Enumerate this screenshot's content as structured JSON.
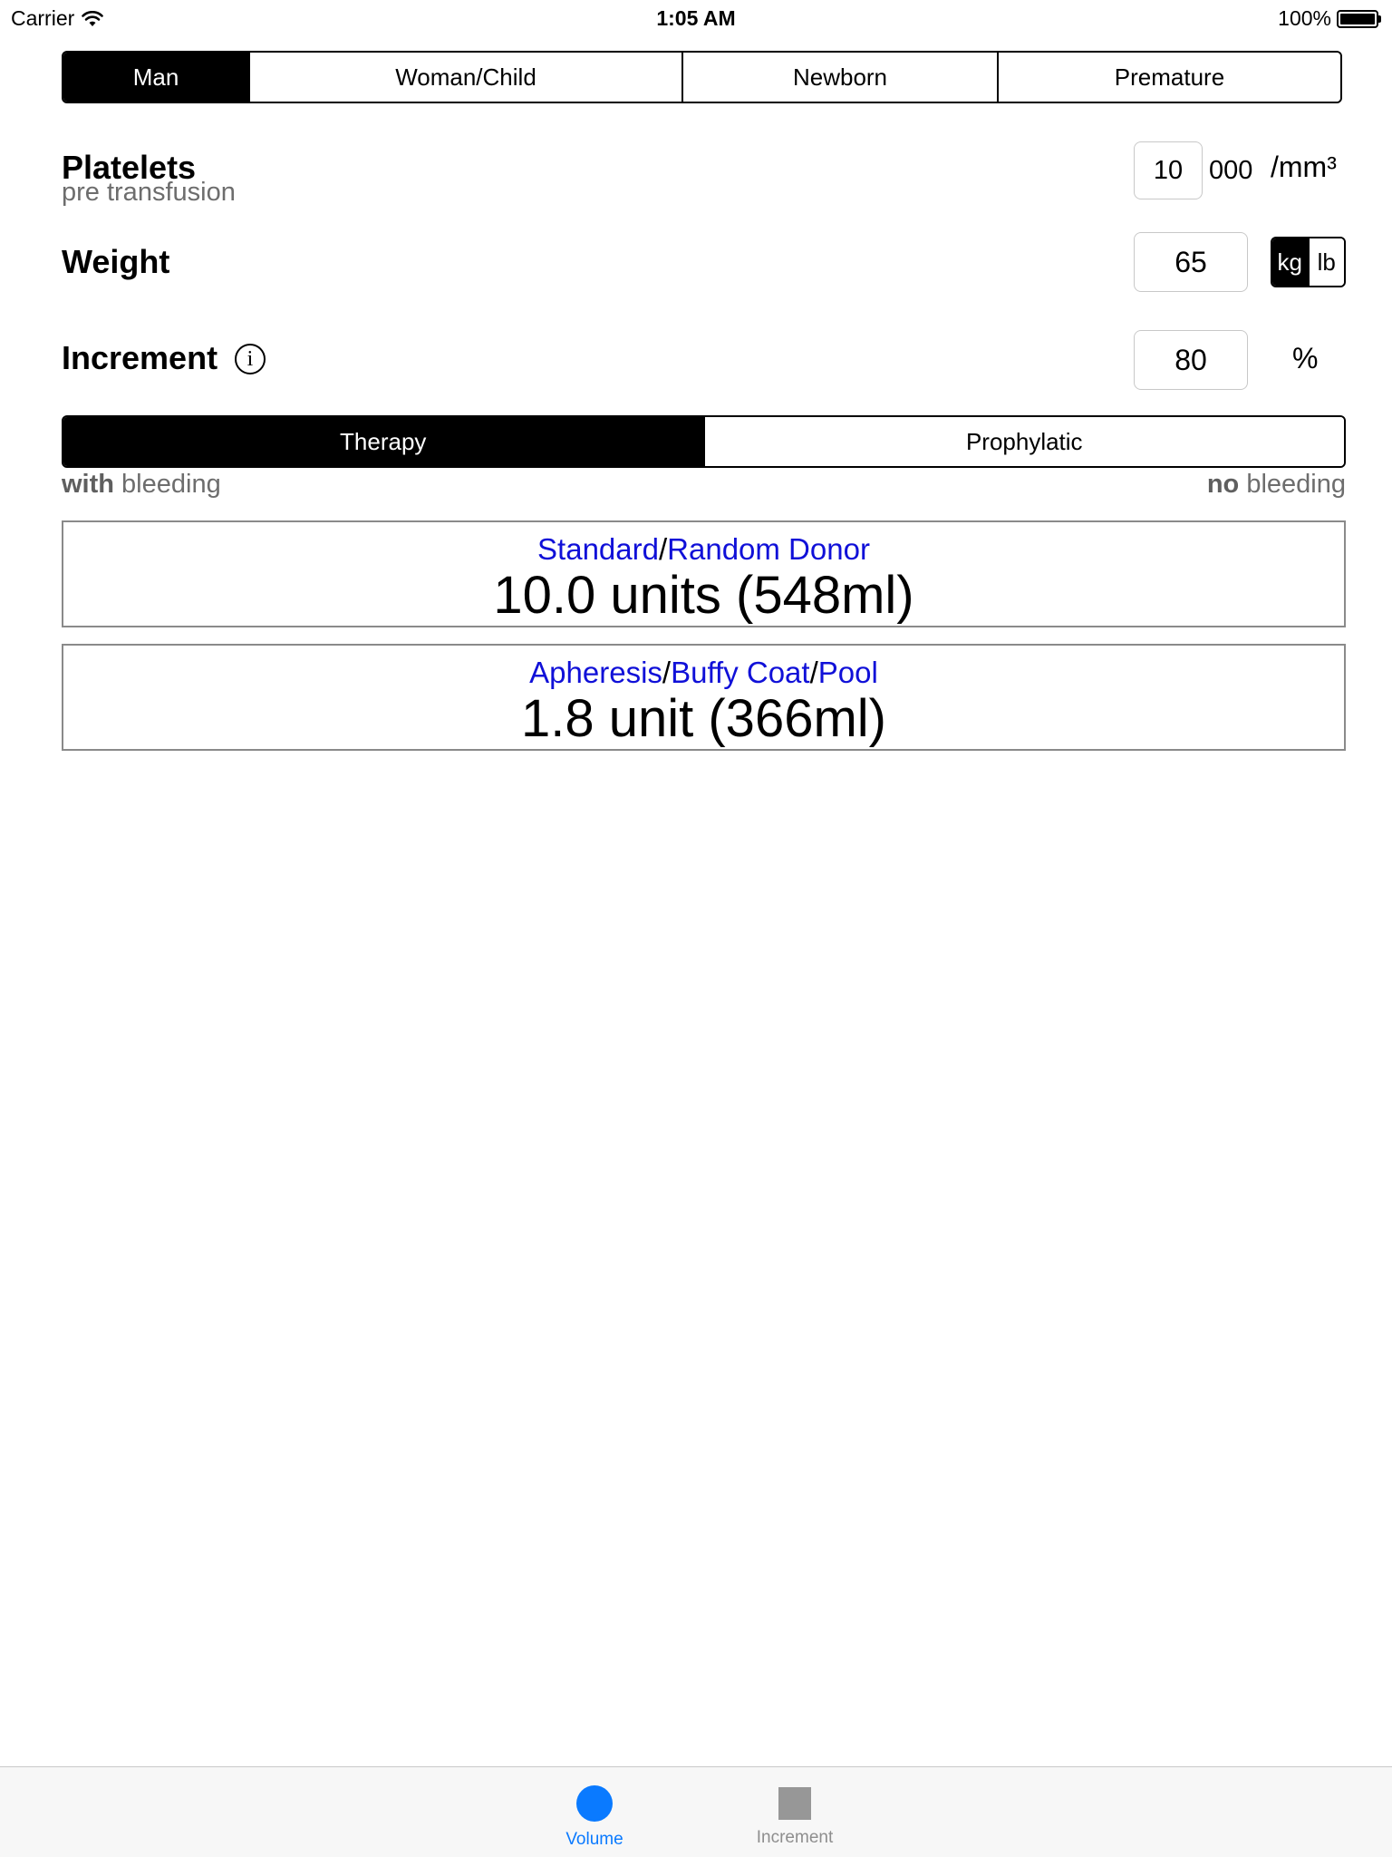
{
  "status_bar": {
    "carrier": "Carrier",
    "time": "1:05 AM",
    "battery": "100%"
  },
  "patient_tabs": [
    {
      "label": "Man",
      "selected": true
    },
    {
      "label": "Woman/Child",
      "selected": false
    },
    {
      "label": "Newborn",
      "selected": false
    },
    {
      "label": "Premature",
      "selected": false
    }
  ],
  "platelets": {
    "label": "Platelets",
    "sublabel": "pre transfusion",
    "value": "10",
    "suffix": "000",
    "unit": "/mm³"
  },
  "weight": {
    "label": "Weight",
    "value": "65",
    "units": [
      {
        "label": "kg",
        "selected": true
      },
      {
        "label": "lb",
        "selected": false
      }
    ]
  },
  "increment": {
    "label": "Increment",
    "info_icon": "info-icon",
    "value": "80",
    "unit": "%"
  },
  "mode_tabs": [
    {
      "label": "Therapy",
      "selected": true
    },
    {
      "label": "Prophylatic",
      "selected": false
    }
  ],
  "mode_hints": {
    "left_bold": "with",
    "left_rest": " bleeding",
    "right_bold": "no",
    "right_rest": " bleeding"
  },
  "results": [
    {
      "links": [
        "Standard",
        "Random Donor"
      ],
      "separator": "/",
      "value": "10.0 units (548ml)"
    },
    {
      "links": [
        "Apheresis",
        "Buffy Coat",
        "Pool"
      ],
      "separator": "/",
      "value": "1.8 unit (366ml)"
    }
  ],
  "tab_bar": [
    {
      "label": "Volume",
      "icon": "circle-icon",
      "active": true
    },
    {
      "label": "Increment",
      "icon": "square-icon",
      "active": false
    }
  ],
  "colors": {
    "link": "#1010d8",
    "active_tab": "#0a7aff",
    "inactive_tab": "#8e8e8e",
    "selected_segment": "#000000"
  }
}
